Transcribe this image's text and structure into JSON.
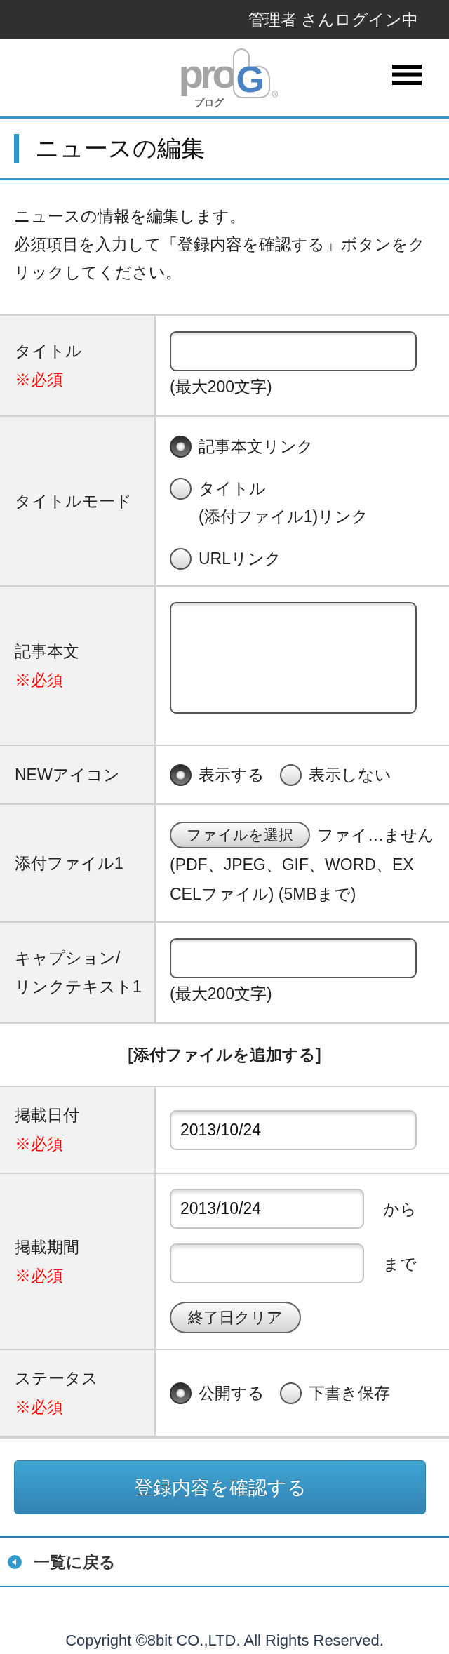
{
  "top_bar": {
    "login_status": "管理者 さんログイン中"
  },
  "header": {
    "logo": {
      "wordmark": "pro",
      "reading": "プログ",
      "mark_letter": "G",
      "registered": "®"
    }
  },
  "page_title": "ニュースの編集",
  "intro": [
    "ニュースの情報を編集します。",
    "必須項目を入力して「登録内容を確認する」ボタンをクリックしてください。"
  ],
  "form": {
    "rows": [
      {
        "kind": "text",
        "label": "タイトル",
        "required_note": "※必須",
        "note": "(最大200文字)"
      },
      {
        "kind": "radio_list",
        "label": "タイトルモード",
        "options": [
          {
            "label": "記事本文リンク",
            "selected": true
          },
          {
            "label": "タイトル\n(添付ファイル1)リンク",
            "selected": false
          },
          {
            "label": "URLリンク",
            "selected": false
          }
        ]
      },
      {
        "kind": "textarea",
        "label": "記事本文",
        "required_note": "※必須"
      },
      {
        "kind": "radio_row",
        "label": "NEWアイコン",
        "options": [
          {
            "label": "表示する",
            "selected": true
          },
          {
            "label": "表示しない",
            "selected": false
          }
        ]
      },
      {
        "kind": "file",
        "label": "添付ファイル1",
        "button": "ファイルを選択",
        "file_status": "ファイ…ません",
        "note": "(PDF、JPEG、GIF、WORD、EXCELファイル) (5MBまで)"
      },
      {
        "kind": "text",
        "label": "キャプション/\nリンクテキスト1",
        "note": "(最大200文字)"
      },
      {
        "kind": "link",
        "text": "[添付ファイルを追加する]"
      },
      {
        "kind": "date",
        "label": "掲載日付",
        "required_note": "※必須",
        "value": "2013/10/24"
      },
      {
        "kind": "date_range",
        "label": "掲載期間",
        "required_note": "※必須",
        "fields": [
          {
            "value": "2013/10/24",
            "suffix": "から"
          },
          {
            "suffix": "まで"
          }
        ],
        "button": "終了日クリア"
      },
      {
        "kind": "radio_row",
        "label": "ステータス",
        "required_note": "※必須",
        "options": [
          {
            "label": "公開する",
            "selected": true
          },
          {
            "label": "下書き保存",
            "selected": false
          }
        ]
      }
    ]
  },
  "submit_button": "登録内容を確認する",
  "back_link": "一覧に戻る",
  "footer": {
    "copyright": "Copyright ©8bit CO.,LTD. All Rights Reserved."
  }
}
